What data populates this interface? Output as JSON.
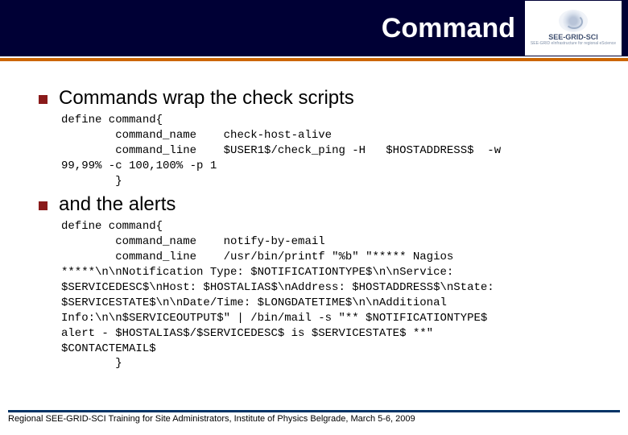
{
  "header": {
    "title": "Command",
    "logo": {
      "line1": "SEE-GRID-SCI",
      "line2": "SEE-GRID eInfrastructure for regional eScience"
    }
  },
  "body": {
    "bullet1": "Commands wrap the check scripts",
    "code1": "define command{\n        command_name    check-host-alive\n        command_line    $USER1$/check_ping -H   $HOSTADDRESS$  -w\n99,99% -c 100,100% -p 1\n        }",
    "bullet2": "and the alerts",
    "code2": "define command{\n        command_name    notify-by-email\n        command_line    /usr/bin/printf \"%b\" \"***** Nagios\n*****\\n\\nNotification Type: $NOTIFICATIONTYPE$\\n\\nService:\n$SERVICEDESC$\\nHost: $HOSTALIAS$\\nAddress: $HOSTADDRESS$\\nState:\n$SERVICESTATE$\\n\\nDate/Time: $LONGDATETIME$\\n\\nAdditional\nInfo:\\n\\n$SERVICEOUTPUT$\" | /bin/mail -s \"** $NOTIFICATIONTYPE$\nalert - $HOSTALIAS$/$SERVICEDESC$ is $SERVICESTATE$ **\"\n$CONTACTEMAIL$\n        }"
  },
  "footer": {
    "text": "Regional SEE-GRID-SCI Training for Site Administrators, Institute of Physics Belgrade, March 5-6, 2009"
  }
}
